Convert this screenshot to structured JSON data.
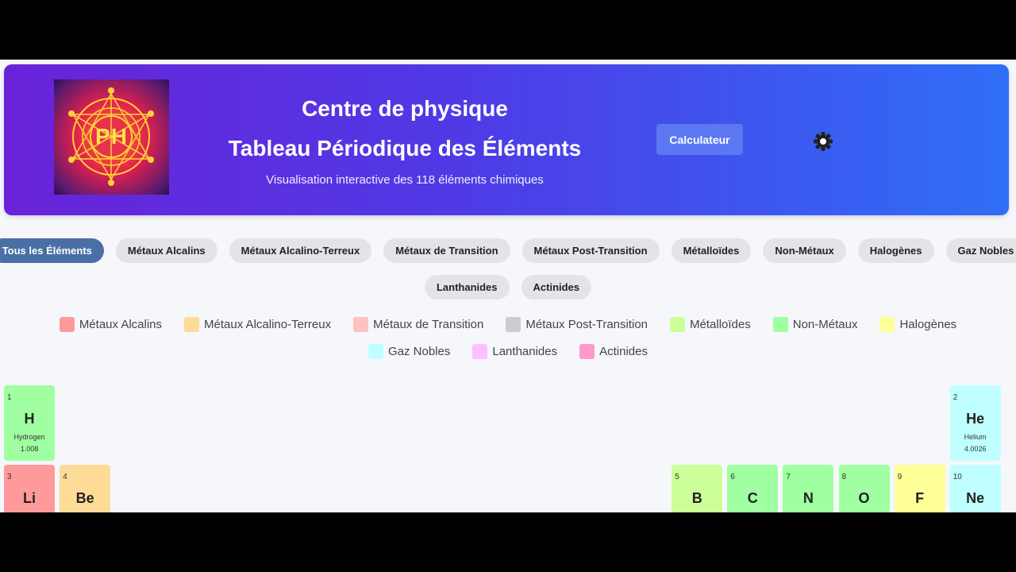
{
  "header": {
    "logo_text": "PH",
    "title1": "Centre de physique",
    "title2": "Tableau Périodique des Éléments",
    "subtitle": "Visualisation interactive des 118 éléments chimiques",
    "calc_label": "Calculateur"
  },
  "filters_row1": [
    {
      "label": "Tous les Éléments",
      "active": true
    },
    {
      "label": "Métaux Alcalins"
    },
    {
      "label": "Métaux Alcalino-Terreux"
    },
    {
      "label": "Métaux de Transition"
    },
    {
      "label": "Métaux Post-Transition"
    },
    {
      "label": "Métalloïdes"
    },
    {
      "label": "Non-Métaux"
    },
    {
      "label": "Halogènes"
    },
    {
      "label": "Gaz Nobles"
    }
  ],
  "filters_row2": [
    {
      "label": "Lanthanides"
    },
    {
      "label": "Actinides"
    }
  ],
  "legend_row1": [
    {
      "label": "Métaux Alcalins",
      "color": "#ff9a9a"
    },
    {
      "label": "Métaux Alcalino-Terreux",
      "color": "#ffdb98"
    },
    {
      "label": "Métaux de Transition",
      "color": "#ffc0c0"
    },
    {
      "label": "Métaux Post-Transition",
      "color": "#cccccc"
    },
    {
      "label": "Métalloïdes",
      "color": "#ccff99"
    },
    {
      "label": "Non-Métaux",
      "color": "#a0ffa0"
    },
    {
      "label": "Halogènes",
      "color": "#ffff99"
    }
  ],
  "legend_row2": [
    {
      "label": "Gaz Nobles",
      "color": "#c0ffff"
    },
    {
      "label": "Lanthanides",
      "color": "#ffbfff"
    },
    {
      "label": "Actinides",
      "color": "#ff99cc"
    }
  ],
  "elements": [
    {
      "num": "1",
      "sym": "H",
      "name": "Hydrogen",
      "mass": "1.008",
      "color": "#a0ffa0",
      "col": 1,
      "row": 1
    },
    {
      "num": "2",
      "sym": "He",
      "name": "Helium",
      "mass": "4.0026",
      "color": "#c0ffff",
      "col": 18,
      "row": 1
    },
    {
      "num": "3",
      "sym": "Li",
      "name": "",
      "mass": "",
      "color": "#ff9a9a",
      "col": 1,
      "row": 2
    },
    {
      "num": "4",
      "sym": "Be",
      "name": "",
      "mass": "",
      "color": "#ffdb98",
      "col": 2,
      "row": 2
    },
    {
      "num": "5",
      "sym": "B",
      "name": "",
      "mass": "",
      "color": "#ccff99",
      "col": 13,
      "row": 2
    },
    {
      "num": "6",
      "sym": "C",
      "name": "",
      "mass": "",
      "color": "#a0ffa0",
      "col": 14,
      "row": 2
    },
    {
      "num": "7",
      "sym": "N",
      "name": "",
      "mass": "",
      "color": "#a0ffa0",
      "col": 15,
      "row": 2
    },
    {
      "num": "8",
      "sym": "O",
      "name": "",
      "mass": "",
      "color": "#a0ffa0",
      "col": 16,
      "row": 2
    },
    {
      "num": "9",
      "sym": "F",
      "name": "",
      "mass": "",
      "color": "#ffff99",
      "col": 17,
      "row": 2
    },
    {
      "num": "10",
      "sym": "Ne",
      "name": "",
      "mass": "",
      "color": "#c0ffff",
      "col": 18,
      "row": 2
    }
  ]
}
